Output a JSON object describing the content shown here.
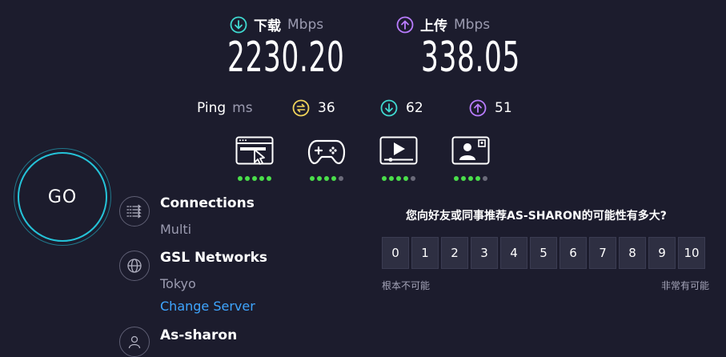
{
  "download": {
    "label": "下载",
    "unit": "Mbps",
    "value": "2230.20",
    "icon": "arrow-down-circle-icon",
    "color": "#3fd9d0"
  },
  "upload": {
    "label": "上传",
    "unit": "Mbps",
    "value": "338.05",
    "icon": "arrow-up-circle-icon",
    "color": "#b97cff"
  },
  "ping": {
    "label": "Ping",
    "unit": "ms",
    "idle": {
      "value": "36",
      "icon": "ping-idle-icon",
      "color": "#f0d35a"
    },
    "down": {
      "value": "62",
      "icon": "arrow-down-circle-icon",
      "color": "#3fd9d0"
    },
    "up": {
      "value": "51",
      "icon": "arrow-up-circle-icon",
      "color": "#b97cff"
    }
  },
  "categories": [
    {
      "icon": "web-browsing-icon",
      "rating": 5,
      "max": 5
    },
    {
      "icon": "gaming-icon",
      "rating": 4,
      "max": 5
    },
    {
      "icon": "video-streaming-icon",
      "rating": 4,
      "max": 5
    },
    {
      "icon": "video-chat-icon",
      "rating": 4,
      "max": 5
    }
  ],
  "go": {
    "label": "GO"
  },
  "connections": {
    "title": "Connections",
    "value": "Multi"
  },
  "server": {
    "title": "GSL Networks",
    "location": "Tokyo",
    "change_label": "Change Server"
  },
  "user": {
    "title": "As-sharon"
  },
  "survey": {
    "question": "您向好友或同事推荐AS-SHARON的可能性有多大?",
    "options": [
      "0",
      "1",
      "2",
      "3",
      "4",
      "5",
      "6",
      "7",
      "8",
      "9",
      "10"
    ],
    "low_label": "根本不可能",
    "high_label": "非常有可能"
  },
  "colors": {
    "background": "#1c1c2d",
    "accent_cyan": "#25c3d8",
    "link": "#3ea5ff",
    "rating_on": "#4ade4a"
  }
}
